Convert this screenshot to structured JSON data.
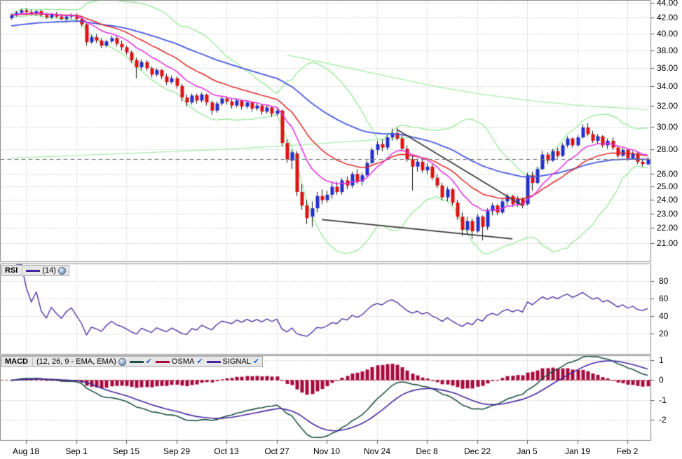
{
  "colors": {
    "background": "#FFFFFF",
    "grid": "#CDCDCD",
    "panel_border": "#8A8A8A",
    "tick": "#555555",
    "candle_up": "#2330CC",
    "candle_down": "#DE1212",
    "wick": "#151515",
    "ema_fast": "#E32EE3",
    "ema_slow": "#E02525",
    "ma_long": "#4758E0",
    "bollinger": "#90E890",
    "long_ma": "#A9EFA9",
    "trendline": "#383838",
    "last_price_line": "#6E6E6E",
    "rsi_line": "#4527A0",
    "macd_line": "#1E5245",
    "macd_signal": "#4527A0",
    "macd_histogram": "#A60A3C",
    "macd_zero_line": "#A63333",
    "header_bg": "#E7E7E7"
  },
  "rsi_panel": {
    "label": "RSI",
    "params": "(14)"
  },
  "macd_panel": {
    "label": "MACD",
    "params": "(12, 26, 9 - EMA, EMA)",
    "check_glyph": "✔",
    "series": [
      {
        "name": "",
        "color": "#1E5245"
      },
      {
        "name": "OSMA",
        "color": "#A60A3C"
      },
      {
        "name": "SIGNAL",
        "color": "#4527A0"
      }
    ]
  },
  "chart_data": [
    {
      "type": "candlestick",
      "title": "",
      "y_axis": {
        "scale": "log",
        "ticks": [
          44,
          42,
          40,
          38,
          36,
          34,
          32,
          30,
          28,
          26,
          25,
          24,
          23,
          22,
          21
        ],
        "tick_format": "0.00"
      },
      "x_axis": {
        "labels": [
          "Aug 18",
          "Sep 1",
          "Sep 15",
          "Sep 29",
          "Oct 13",
          "Oct 27",
          "Nov 10",
          "Nov 24",
          "Dec 8",
          "Dec 22",
          "Jan 5",
          "Jan 19",
          "Feb 2"
        ],
        "label_bar_indices": [
          3,
          13,
          23,
          33,
          43,
          53,
          63,
          73,
          83,
          93,
          103,
          113,
          123
        ]
      },
      "last_price": 27.2,
      "candles": [
        [
          42.0,
          42.6,
          41.8,
          42.4
        ],
        [
          42.4,
          42.9,
          42.2,
          42.7
        ],
        [
          42.7,
          43.2,
          42.5,
          43.0
        ],
        [
          43.0,
          43.3,
          42.6,
          42.8
        ],
        [
          42.8,
          43.1,
          42.4,
          42.6
        ],
        [
          42.6,
          43.0,
          42.3,
          42.9
        ],
        [
          42.9,
          43.1,
          42.2,
          42.4
        ],
        [
          42.4,
          42.7,
          41.9,
          42.1
        ],
        [
          42.1,
          42.6,
          41.9,
          42.5
        ],
        [
          42.5,
          42.8,
          42.0,
          42.2
        ],
        [
          42.2,
          42.5,
          41.7,
          41.9
        ],
        [
          41.9,
          42.4,
          41.6,
          42.2
        ],
        [
          42.2,
          42.6,
          41.9,
          42.4
        ],
        [
          42.4,
          42.6,
          41.6,
          41.9
        ],
        [
          41.9,
          42.0,
          40.9,
          41.2
        ],
        [
          41.2,
          41.4,
          38.6,
          39.0
        ],
        [
          39.0,
          39.9,
          38.8,
          39.6
        ],
        [
          39.6,
          40.0,
          38.9,
          39.2
        ],
        [
          39.2,
          39.5,
          38.3,
          38.6
        ],
        [
          38.6,
          39.3,
          38.4,
          39.1
        ],
        [
          39.1,
          39.8,
          38.9,
          39.5
        ],
        [
          39.5,
          39.7,
          38.5,
          38.8
        ],
        [
          38.8,
          39.2,
          38.0,
          38.4
        ],
        [
          38.4,
          38.6,
          37.5,
          37.8
        ],
        [
          37.8,
          38.0,
          36.6,
          36.9
        ],
        [
          36.9,
          37.2,
          34.9,
          36.1
        ],
        [
          36.1,
          37.0,
          35.8,
          36.7
        ],
        [
          36.7,
          36.9,
          35.7,
          36.0
        ],
        [
          36.0,
          36.2,
          35.0,
          35.3
        ],
        [
          35.3,
          36.0,
          35.1,
          35.8
        ],
        [
          35.8,
          35.9,
          34.8,
          35.1
        ],
        [
          35.1,
          35.4,
          34.2,
          34.5
        ],
        [
          34.5,
          35.2,
          34.3,
          34.9
        ],
        [
          34.9,
          35.1,
          33.8,
          34.1
        ],
        [
          34.1,
          34.3,
          32.5,
          32.9
        ],
        [
          32.9,
          33.2,
          32.0,
          32.4
        ],
        [
          32.4,
          33.3,
          32.2,
          33.1
        ],
        [
          33.1,
          33.3,
          32.3,
          32.6
        ],
        [
          32.6,
          33.4,
          32.4,
          33.2
        ],
        [
          33.2,
          33.3,
          32.1,
          32.4
        ],
        [
          32.4,
          32.6,
          31.2,
          31.6
        ],
        [
          31.6,
          32.5,
          31.4,
          32.3
        ],
        [
          32.3,
          33.0,
          32.1,
          32.8
        ],
        [
          32.8,
          33.0,
          32.2,
          32.5
        ],
        [
          32.5,
          32.7,
          31.8,
          32.1
        ],
        [
          32.1,
          32.8,
          31.9,
          32.6
        ],
        [
          32.6,
          32.7,
          31.7,
          32.0
        ],
        [
          32.0,
          32.6,
          31.8,
          32.4
        ],
        [
          32.4,
          32.5,
          31.5,
          31.8
        ],
        [
          31.8,
          32.4,
          31.6,
          32.1
        ],
        [
          32.1,
          32.2,
          31.2,
          31.5
        ],
        [
          31.5,
          32.1,
          31.3,
          31.9
        ],
        [
          31.9,
          32.0,
          31.0,
          31.3
        ],
        [
          31.3,
          31.9,
          31.1,
          31.6
        ],
        [
          31.6,
          31.7,
          28.3,
          28.6
        ],
        [
          28.6,
          28.9,
          26.9,
          27.2
        ],
        [
          27.1,
          28.0,
          26.4,
          27.8
        ],
        [
          27.7,
          27.9,
          24.3,
          24.6
        ],
        [
          24.6,
          25.2,
          23.3,
          23.6
        ],
        [
          23.6,
          24.0,
          22.3,
          22.7
        ],
        [
          22.8,
          23.9,
          22.1,
          23.4
        ],
        [
          23.4,
          24.6,
          23.1,
          24.3
        ],
        [
          24.3,
          24.8,
          23.7,
          24.0
        ],
        [
          24.0,
          24.7,
          23.8,
          24.4
        ],
        [
          24.4,
          25.3,
          24.1,
          25.0
        ],
        [
          25.0,
          25.4,
          24.4,
          24.6
        ],
        [
          24.6,
          25.7,
          24.4,
          25.5
        ],
        [
          25.5,
          25.8,
          24.8,
          25.1
        ],
        [
          25.1,
          26.2,
          24.9,
          26.0
        ],
        [
          26.0,
          26.4,
          25.2,
          25.4
        ],
        [
          25.4,
          26.1,
          25.1,
          25.9
        ],
        [
          25.9,
          27.1,
          25.8,
          26.9
        ],
        [
          26.9,
          28.2,
          26.8,
          28.0
        ],
        [
          28.0,
          28.8,
          27.6,
          28.5
        ],
        [
          28.5,
          28.9,
          27.9,
          28.2
        ],
        [
          28.2,
          29.3,
          28.0,
          29.1
        ],
        [
          29.1,
          29.9,
          28.8,
          29.5
        ],
        [
          29.5,
          30.0,
          28.8,
          29.0
        ],
        [
          29.0,
          29.3,
          27.9,
          28.1
        ],
        [
          28.1,
          28.4,
          27.0,
          27.2
        ],
        [
          27.2,
          27.5,
          24.7,
          26.6
        ],
        [
          26.6,
          27.3,
          26.2,
          27.0
        ],
        [
          27.0,
          27.2,
          26.1,
          26.3
        ],
        [
          26.3,
          26.9,
          26.0,
          26.6
        ],
        [
          26.6,
          26.8,
          25.5,
          25.7
        ],
        [
          25.7,
          26.0,
          24.9,
          25.1
        ],
        [
          25.1,
          25.3,
          24.0,
          24.2
        ],
        [
          24.2,
          25.0,
          23.9,
          24.8
        ],
        [
          24.8,
          24.9,
          23.6,
          23.8
        ],
        [
          23.8,
          24.0,
          22.6,
          22.8
        ],
        [
          22.8,
          23.1,
          21.5,
          21.9
        ],
        [
          21.9,
          22.8,
          21.6,
          22.5
        ],
        [
          22.5,
          22.7,
          21.3,
          21.8
        ],
        [
          21.8,
          23.0,
          21.7,
          22.8
        ],
        [
          22.8,
          22.9,
          21.2,
          22.1
        ],
        [
          22.1,
          23.4,
          21.9,
          23.2
        ],
        [
          23.2,
          23.8,
          22.9,
          23.6
        ],
        [
          23.6,
          23.7,
          22.9,
          23.1
        ],
        [
          23.1,
          24.1,
          23.0,
          23.9
        ],
        [
          23.9,
          24.5,
          23.6,
          24.3
        ],
        [
          24.3,
          24.4,
          23.5,
          23.7
        ],
        [
          23.7,
          24.3,
          23.5,
          24.1
        ],
        [
          24.1,
          24.2,
          23.4,
          23.6
        ],
        [
          23.7,
          26.1,
          23.6,
          25.9
        ],
        [
          25.9,
          26.2,
          24.7,
          25.3
        ],
        [
          25.3,
          26.6,
          25.2,
          26.4
        ],
        [
          26.4,
          27.9,
          26.3,
          27.6
        ],
        [
          27.6,
          27.8,
          26.8,
          27.1
        ],
        [
          27.1,
          28.1,
          27.0,
          27.9
        ],
        [
          27.9,
          28.2,
          27.3,
          27.5
        ],
        [
          27.5,
          28.6,
          27.4,
          28.4
        ],
        [
          28.4,
          29.2,
          28.2,
          29.0
        ],
        [
          29.0,
          29.1,
          28.2,
          28.4
        ],
        [
          28.4,
          29.3,
          28.3,
          29.1
        ],
        [
          29.1,
          30.3,
          29.0,
          30.0
        ],
        [
          30.0,
          30.4,
          29.2,
          29.4
        ],
        [
          29.4,
          29.7,
          28.6,
          28.8
        ],
        [
          28.8,
          29.4,
          28.5,
          29.2
        ],
        [
          29.2,
          29.3,
          28.2,
          28.4
        ],
        [
          28.4,
          29.0,
          28.1,
          28.8
        ],
        [
          28.8,
          29.1,
          28.0,
          28.2
        ],
        [
          28.2,
          28.4,
          27.3,
          27.5
        ],
        [
          27.5,
          28.2,
          27.4,
          28.0
        ],
        [
          28.0,
          28.1,
          27.1,
          27.3
        ],
        [
          27.3,
          27.9,
          27.2,
          27.7
        ],
        [
          27.7,
          27.8,
          26.8,
          27.0
        ],
        [
          27.0,
          27.2,
          26.6,
          26.8
        ],
        [
          26.8,
          27.4,
          26.7,
          27.2
        ]
      ],
      "overlays": {
        "ema_fast": {
          "period": 10
        },
        "ema_slow": {
          "period": 20
        },
        "ma_long": {
          "period": 45,
          "start_value": 41.0
        },
        "bollinger": {
          "period": 20,
          "stddev": 2
        },
        "long_ma_lines": [
          {
            "points": [
              [
                55,
                37.5
              ],
              [
                65,
                36.3
              ],
              [
                76,
                35.0
              ],
              [
                85,
                34.0
              ],
              [
                95,
                33.15
              ],
              [
                105,
                32.5
              ],
              [
                115,
                32.05
              ],
              [
                127,
                31.7
              ]
            ]
          },
          {
            "points": [
              [
                0,
                27.3
              ],
              [
                20,
                27.65
              ],
              [
                40,
                28.0
              ],
              [
                55,
                28.35
              ],
              [
                70,
                28.8
              ],
              [
                80,
                29.1
              ]
            ]
          }
        ],
        "trendlines": [
          {
            "points": [
              [
                77,
                29.8
              ],
              [
                102,
                23.6
              ]
            ]
          },
          {
            "points": [
              [
                62,
                22.6
              ],
              [
                100,
                21.3
              ]
            ]
          }
        ]
      }
    },
    {
      "type": "line",
      "indicator": "RSI",
      "period": 14,
      "source": "close",
      "y_ticks": [
        80,
        60,
        40,
        20
      ]
    },
    {
      "type": "macd",
      "fast": 12,
      "slow": 26,
      "signal": 9,
      "histogram": "OSMA",
      "y_ticks": [
        1,
        0,
        -1,
        -2
      ]
    }
  ]
}
